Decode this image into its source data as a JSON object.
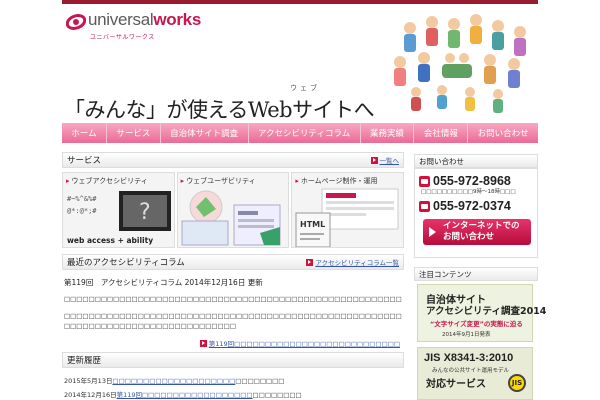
{
  "brand": {
    "name_light": "universal",
    "name_bold": "works",
    "kana": "ユニバーサルワークス",
    "accent": "#c8174e",
    "top_bar_color": "#9a1b2d"
  },
  "hero": {
    "title": "「みんな」が使えるWebサイトへ",
    "ruby": "ウェブ"
  },
  "nav": {
    "items": [
      "ホーム",
      "サービス",
      "自治体サイト調査",
      "アクセシビリティコラム",
      "業務実績",
      "会社情報",
      "お問い合わせ"
    ],
    "bg_top": "#f8a8c2",
    "bg_bottom": "#ea6a96"
  },
  "services": {
    "heading": "サービス",
    "list_link": "一覧へ",
    "cards": [
      {
        "label": "ウェブアクセシビリティ",
        "art_text": "web  access + ability"
      },
      {
        "label": "ウェブユーザビリティ"
      },
      {
        "label": "ホームページ制作・運用"
      }
    ]
  },
  "column": {
    "heading": "最近のアクセシビリティコラム",
    "list_link": "アクセシビリティコラム一覧",
    "article_title": "第119回　アクセシビリティコラム 2014年12月16日 更新",
    "paragraph1": "□□□□□□□□□□□□□□□□□□□□□□□□□□□□□□□□□□□□□□□□□□□□□□□□□□□□□□□□□□□□□□□□□□□□□□□□□□",
    "paragraph2a": "□□□□□□□□□□□□□□□□□□□□□□□□□□□□□□□□□□□□□□□□□□□□□□□□□□□□□□□□□□□□□□□□□□□□□□□□□□",
    "paragraph2b": "□□□□□□□□□□□□□□□□□□□□□□□□□□□□",
    "more_link": "第119回□□□□□□□□□□□□□□□□□□□□□□□□□□□"
  },
  "history": {
    "heading": "更新履歴",
    "items": [
      {
        "date": "2015年5月13日",
        "link": "□□□□□□□□□□□□□□□□□□□□",
        "rest": "□□□□□□□□"
      },
      {
        "date": "2014年12月16日",
        "link": "第119回□□□□□□□□□□□□□□□□□□",
        "rest": "□□□□□□□□"
      }
    ]
  },
  "contact": {
    "heading": "お問い合わせ",
    "phone1": "055-972-8968",
    "hours": "□□□□□□□□□□9時～18時□□□",
    "phone2": "055-972-0374",
    "button_line1": "インターネットでの",
    "button_line2": "お問い合わせ"
  },
  "featured": {
    "heading": "注目コンテンツ",
    "banner1": {
      "line1": "自治体サイト",
      "line2": "アクセシビリティ調査2014",
      "line3": "“文字サイズ変更”の実態に迫る",
      "line4": "2014年9月1日発表"
    },
    "banner2": {
      "line1": "JIS X8341-3:2010",
      "line2": "みんなの公共サイト運用モデル",
      "line3": "対応サービス",
      "badge": "JIS"
    }
  }
}
